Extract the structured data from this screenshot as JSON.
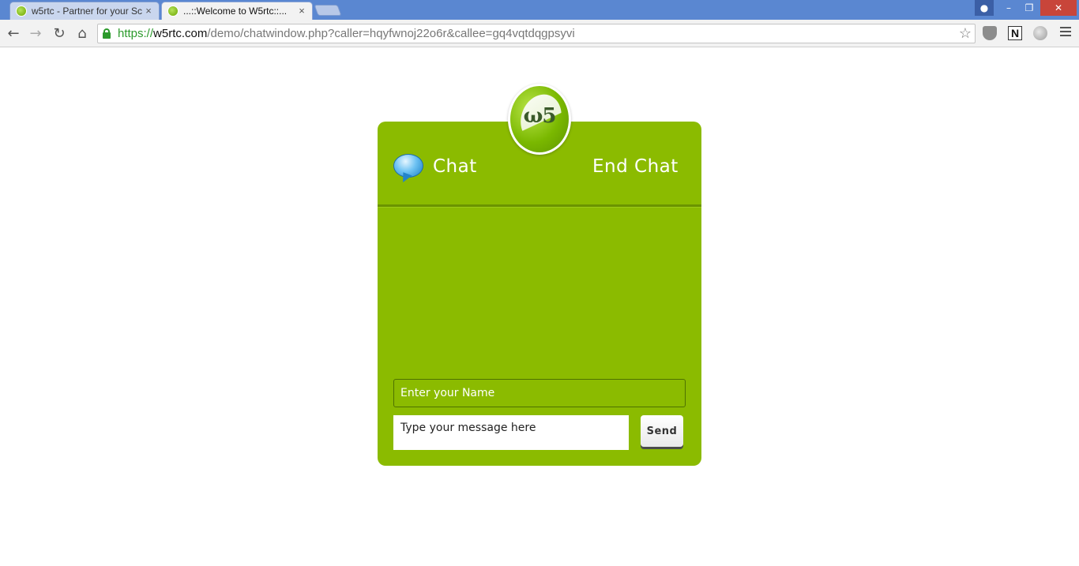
{
  "browser": {
    "tabs": [
      {
        "title": "w5rtc - Partner for your Sc",
        "close": "×",
        "active": false
      },
      {
        "title": "...::Welcome to W5rtc::...",
        "close": "×",
        "active": true
      }
    ],
    "url": {
      "scheme": "https://",
      "host": "w5rtc.com",
      "path": "/demo/chatwindow.php?caller=hqyfwnoj22o6r&callee=gq4vqtdqgpsyvi"
    },
    "nav": {
      "back": "←",
      "forward": "→",
      "reload": "↻",
      "home": "⌂",
      "star": "☆"
    },
    "window": {
      "minimize": "–",
      "maximize": "❐",
      "close": "✕",
      "user": "●"
    },
    "extensions": [
      "shield-extension",
      "onenote-extension",
      "globe-extension"
    ],
    "extension_n_label": "N"
  },
  "chat": {
    "logo_text": "ω5",
    "title": "Chat",
    "end_chat": "End Chat",
    "name_placeholder": "Enter your Name",
    "message_placeholder": "Type your message here",
    "send_label": "Send",
    "messages": []
  },
  "colors": {
    "accent": "#8bbb00",
    "titlebar": "#5a87d1",
    "secure_green": "#2c9a2c"
  }
}
